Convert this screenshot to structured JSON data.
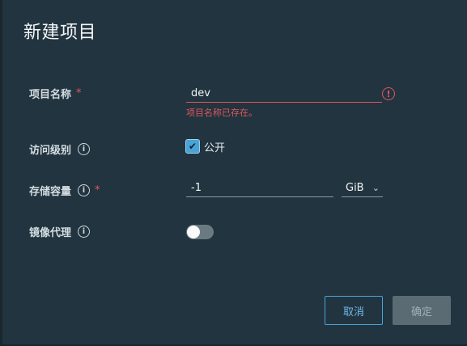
{
  "dialog": {
    "title": "新建项目"
  },
  "project_name": {
    "label": "项目名称",
    "required_mark": "*",
    "value": "dev",
    "error_icon": "exclamation-circle-icon",
    "error_message": "项目名称已存在。"
  },
  "access_level": {
    "label": "访问级别",
    "info_icon": "info-circle-icon",
    "checkbox_checked": true,
    "checkbox_label": "公开"
  },
  "storage_quota": {
    "label": "存储容量",
    "info_icon": "info-circle-icon",
    "required_mark": "*",
    "value": "-1",
    "unit": "GiB"
  },
  "mirror_proxy": {
    "label": "镜像代理",
    "info_icon": "info-circle-icon",
    "enabled": false
  },
  "buttons": {
    "cancel": "取消",
    "confirm": "确定"
  },
  "colors": {
    "error": "#e0575d",
    "accent": "#4aa3d6",
    "background": "#22343f"
  }
}
